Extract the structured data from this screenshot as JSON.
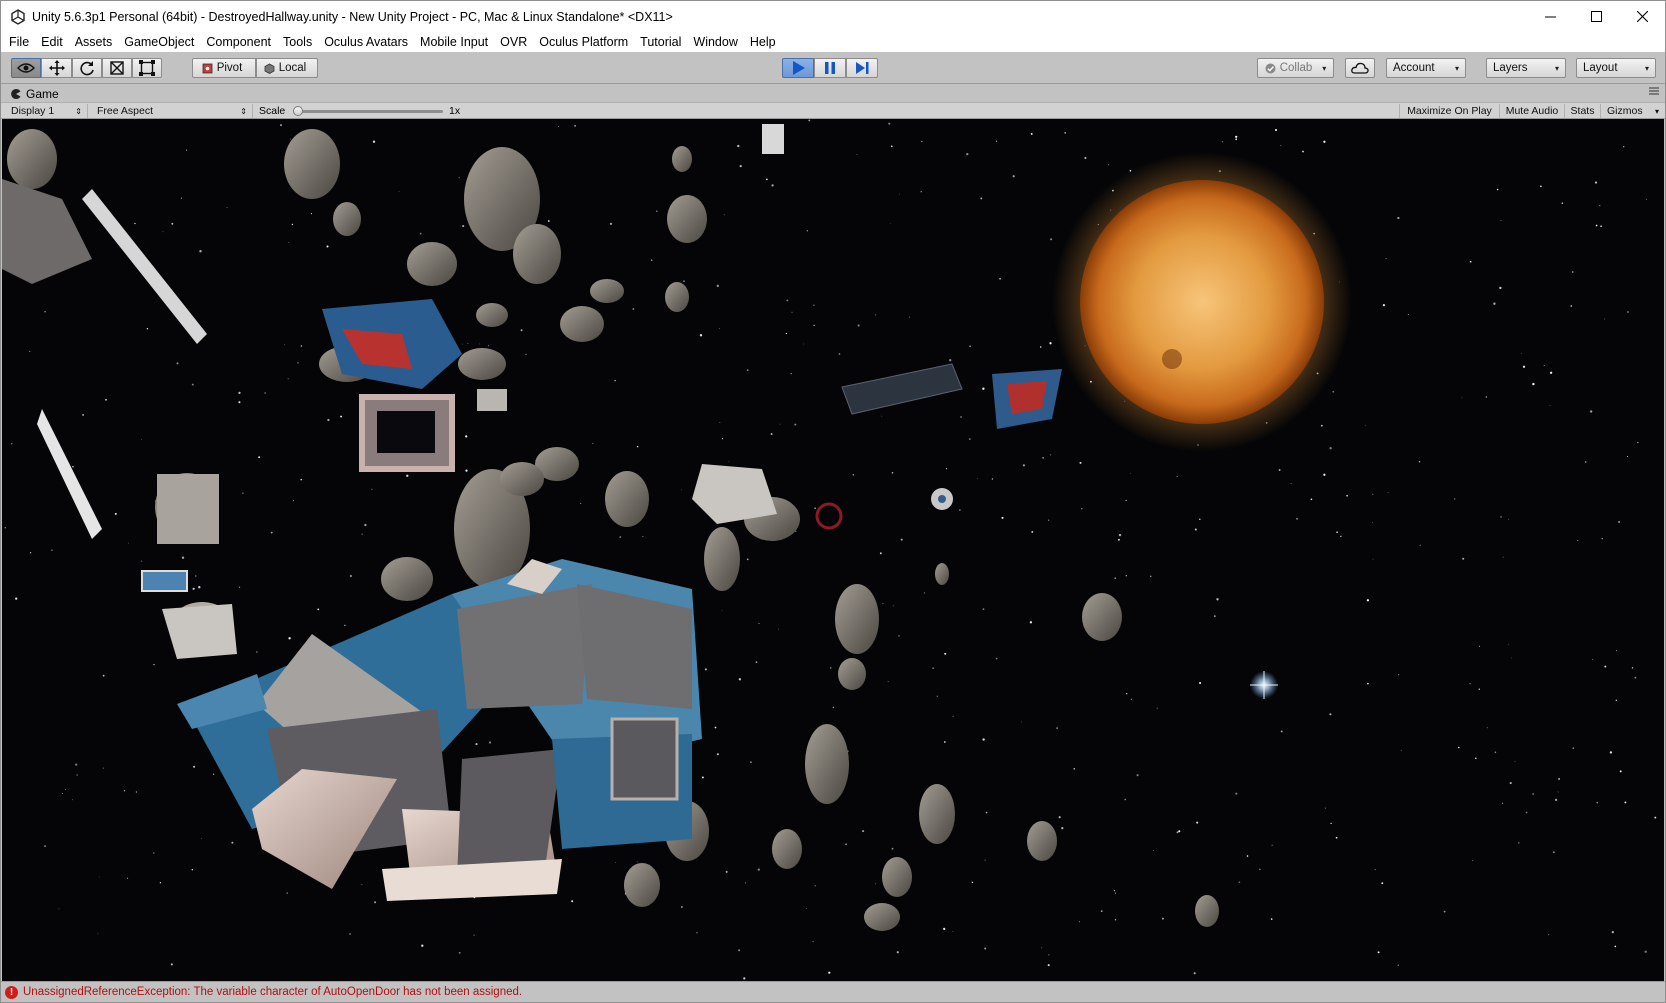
{
  "window": {
    "title": "Unity 5.6.3p1 Personal (64bit) - DestroyedHallway.unity - New Unity Project - PC, Mac & Linux Standalone* <DX11>",
    "controls": [
      "minimize-icon",
      "maximize-icon",
      "close-icon"
    ]
  },
  "menu": [
    "File",
    "Edit",
    "Assets",
    "GameObject",
    "Component",
    "Tools",
    "Oculus Avatars",
    "Mobile Input",
    "OVR",
    "Oculus Platform",
    "Tutorial",
    "Window",
    "Help"
  ],
  "toolbar": {
    "transform_tools": [
      "hand-eye-icon",
      "move-icon",
      "rotate-icon",
      "scale-icon",
      "rect-icon"
    ],
    "pivot_label": "Pivot",
    "local_label": "Local",
    "play_controls": [
      "play-icon",
      "pause-icon",
      "step-icon"
    ],
    "play_active": true,
    "collab_label": "Collab",
    "account_label": "Account",
    "layers_label": "Layers",
    "layout_label": "Layout",
    "accent_color": "#3a78d8"
  },
  "game_tab": {
    "label": "Game",
    "display": "Display 1",
    "aspect": "Free Aspect",
    "scale_label": "Scale",
    "scale_value": "1x",
    "scale_fraction": 0.0,
    "toggles": [
      "Maximize On Play",
      "Mute Audio",
      "Stats",
      "Gizmos"
    ]
  },
  "status": {
    "message": "UnassignedReferenceException: The variable character of AutoOpenDoor has not been assigned.",
    "color": "#b01010"
  }
}
